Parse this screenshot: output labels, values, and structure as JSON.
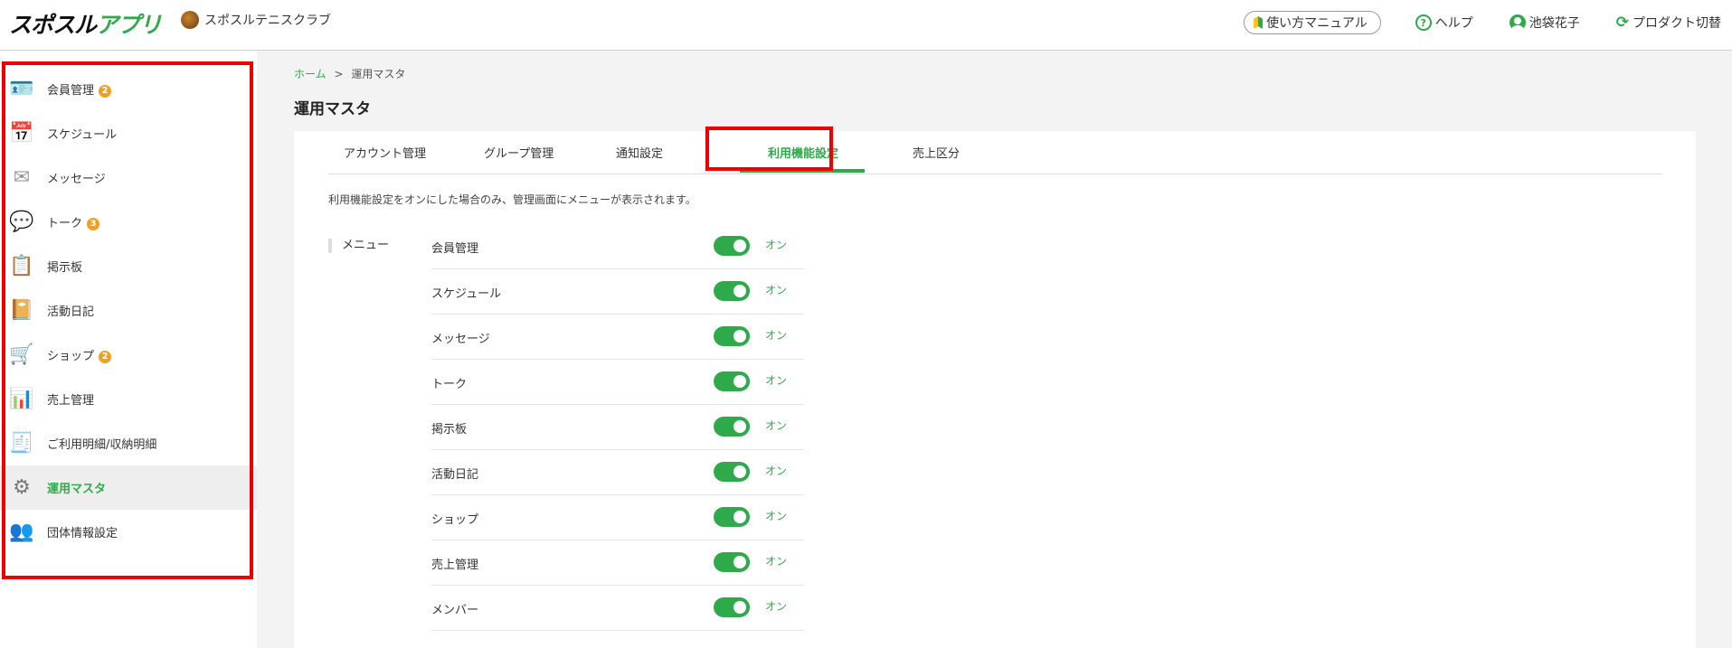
{
  "header": {
    "logo_text": "スポスル",
    "logo_green": "アプリ",
    "org_name": "スポスルテニスクラブ",
    "manual": "使い方マニュアル",
    "help": "ヘルプ",
    "user": "池袋花子",
    "product_switch": "プロダクト切替"
  },
  "sidebar": {
    "items": [
      {
        "label": "会員管理",
        "badge": "2",
        "icon": "member-card-icon"
      },
      {
        "label": "スケジュール",
        "badge": "",
        "icon": "calendar-icon"
      },
      {
        "label": "メッセージ",
        "badge": "",
        "icon": "envelope-icon"
      },
      {
        "label": "トーク",
        "badge": "3",
        "icon": "chat-bubble-icon"
      },
      {
        "label": "掲示板",
        "badge": "",
        "icon": "bulletin-board-icon"
      },
      {
        "label": "活動日記",
        "badge": "",
        "icon": "diary-icon"
      },
      {
        "label": "ショップ",
        "badge": "2",
        "icon": "shopping-cart-icon"
      },
      {
        "label": "売上管理",
        "badge": "",
        "icon": "sales-icon"
      },
      {
        "label": "ご利用明細/収納明細",
        "badge": "",
        "icon": "receipt-icon"
      },
      {
        "label": "運用マスタ",
        "badge": "",
        "icon": "gear-wrench-icon",
        "active": true
      },
      {
        "label": "団体情報設定",
        "badge": "",
        "icon": "group-settings-icon"
      }
    ]
  },
  "breadcrumb": {
    "home": "ホーム",
    "separator": ">",
    "current": "運用マスタ"
  },
  "page_title": "運用マスタ",
  "tabs": [
    {
      "label": "アカウント管理"
    },
    {
      "label": "グループ管理"
    },
    {
      "label": "通知設定"
    },
    {
      "label": "利用機能設定",
      "active": true
    },
    {
      "label": "売上区分"
    }
  ],
  "description": "利用機能設定をオンにした場合のみ、管理画面にメニューが表示されます。",
  "menu_section": {
    "label": "メニュー",
    "on_text": "オン",
    "rows": [
      {
        "label": "会員管理",
        "state": "オン"
      },
      {
        "label": "スケジュール",
        "state": "オン"
      },
      {
        "label": "メッセージ",
        "state": "オン"
      },
      {
        "label": "トーク",
        "state": "オン"
      },
      {
        "label": "掲示板",
        "state": "オン"
      },
      {
        "label": "活動日記",
        "state": "オン"
      },
      {
        "label": "ショップ",
        "state": "オン"
      },
      {
        "label": "売上管理",
        "state": "オン"
      },
      {
        "label": "メンバー",
        "state": "オン"
      }
    ]
  },
  "colors": {
    "accent": "#2eaa4a",
    "badge": "#f0a020",
    "highlight": "#ee0000"
  }
}
